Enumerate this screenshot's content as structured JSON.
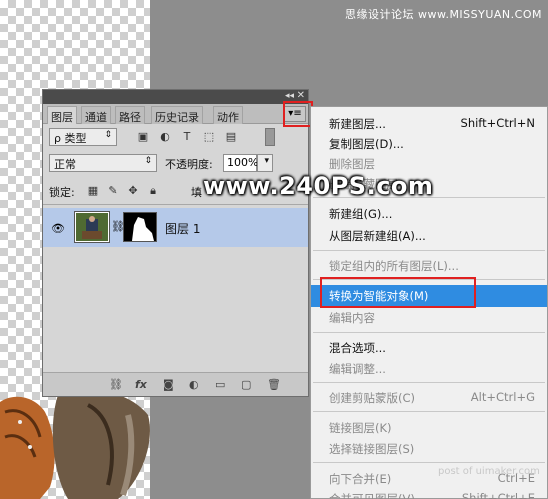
{
  "watermarks": {
    "header": "思缘设计论坛 www.MISSYUAN.COM",
    "center": "www.240PS.com",
    "footer": "post of uimaker.com"
  },
  "panel": {
    "tabs": [
      "图层",
      "通道",
      "路径",
      "历史记录",
      "动作"
    ],
    "menu_button": "▾≡",
    "filter_select": "ρ 类型",
    "blend_mode": "正常",
    "opacity_label": "不透明度:",
    "opacity_value": "100%",
    "lock_label": "锁定:",
    "fill_label": "填",
    "layer_name": "图层 1"
  },
  "menu": {
    "items": [
      {
        "label": "新建图层...",
        "shortcut": "Shift+Ctrl+N",
        "enabled": true
      },
      {
        "label": "复制图层(D)...",
        "shortcut": "",
        "enabled": true
      },
      {
        "label": "删除图层",
        "shortcut": "",
        "enabled": false
      },
      {
        "label": "删除隐藏图层",
        "shortcut": "",
        "enabled": false
      },
      {
        "label": "新建组(G)...",
        "shortcut": "",
        "enabled": true
      },
      {
        "label": "从图层新建组(A)...",
        "shortcut": "",
        "enabled": true
      },
      {
        "label": "锁定组内的所有图层(L)...",
        "shortcut": "",
        "enabled": false
      },
      {
        "label": "转换为智能对象(M)",
        "shortcut": "",
        "enabled": true
      },
      {
        "label": "编辑内容",
        "shortcut": "",
        "enabled": false
      },
      {
        "label": "混合选项...",
        "shortcut": "",
        "enabled": true
      },
      {
        "label": "编辑调整...",
        "shortcut": "",
        "enabled": false
      },
      {
        "label": "创建剪贴蒙版(C)",
        "shortcut": "Alt+Ctrl+G",
        "enabled": false
      },
      {
        "label": "链接图层(K)",
        "shortcut": "",
        "enabled": false
      },
      {
        "label": "选择链接图层(S)",
        "shortcut": "",
        "enabled": false
      },
      {
        "label": "向下合并(E)",
        "shortcut": "Ctrl+E",
        "enabled": false
      },
      {
        "label": "合并可见图层(V)",
        "shortcut": "Shift+Ctrl+E",
        "enabled": false
      }
    ]
  },
  "colors": {
    "highlight": "#2f8ce1",
    "selected_layer": "#b5c9e9",
    "annotation_red": "#e02020"
  }
}
